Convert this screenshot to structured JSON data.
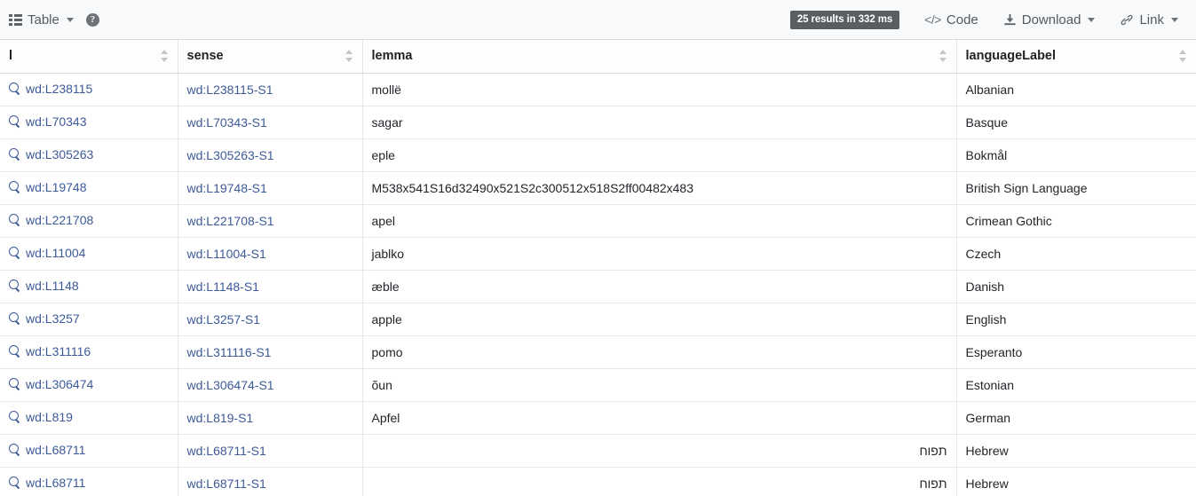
{
  "toolbar": {
    "table_label": "Table",
    "table_icon": "list-icon",
    "help_icon": "help-circle-icon",
    "help_glyph": "?",
    "results_badge": "25 results in 332 ms",
    "code_label": "Code",
    "code_glyph": "</>",
    "download_label": "Download",
    "download_icon": "download-icon",
    "link_label": "Link",
    "link_icon": "link-icon",
    "badge_bg": "#5a5e62",
    "toolbar_bg": "#f8f9fa"
  },
  "table": {
    "columns": [
      {
        "key": "l",
        "label": "l",
        "sortable": true
      },
      {
        "key": "sense",
        "label": "sense",
        "sortable": true
      },
      {
        "key": "lemma",
        "label": "lemma",
        "sortable": true
      },
      {
        "key": "languageLabel",
        "label": "languageLabel",
        "sortable": true
      }
    ],
    "link_color": "#3d5a99",
    "rows": [
      {
        "l": "wd:L238115",
        "sense": "wd:L238115-S1",
        "lemma": "mollë",
        "languageLabel": "Albanian"
      },
      {
        "l": "wd:L70343",
        "sense": "wd:L70343-S1",
        "lemma": "sagar",
        "languageLabel": "Basque"
      },
      {
        "l": "wd:L305263",
        "sense": "wd:L305263-S1",
        "lemma": "eple",
        "languageLabel": "Bokmål"
      },
      {
        "l": "wd:L19748",
        "sense": "wd:L19748-S1",
        "lemma": "M538x541S16d32490x521S2c300512x518S2ff00482x483",
        "languageLabel": "British Sign Language"
      },
      {
        "l": "wd:L221708",
        "sense": "wd:L221708-S1",
        "lemma": "apel",
        "languageLabel": "Crimean Gothic"
      },
      {
        "l": "wd:L11004",
        "sense": "wd:L11004-S1",
        "lemma": "jablko",
        "languageLabel": "Czech"
      },
      {
        "l": "wd:L1148",
        "sense": "wd:L1148-S1",
        "lemma": "æble",
        "languageLabel": "Danish"
      },
      {
        "l": "wd:L3257",
        "sense": "wd:L3257-S1",
        "lemma": "apple",
        "languageLabel": "English"
      },
      {
        "l": "wd:L311116",
        "sense": "wd:L311116-S1",
        "lemma": "pomo",
        "languageLabel": "Esperanto"
      },
      {
        "l": "wd:L306474",
        "sense": "wd:L306474-S1",
        "lemma": "õun",
        "languageLabel": "Estonian"
      },
      {
        "l": "wd:L819",
        "sense": "wd:L819-S1",
        "lemma": "Apfel",
        "languageLabel": "German"
      },
      {
        "l": "wd:L68711",
        "sense": "wd:L68711-S1",
        "lemma": "תפוח",
        "languageLabel": "Hebrew"
      },
      {
        "l": "wd:L68711",
        "sense": "wd:L68711-S1",
        "lemma": "תפוח",
        "languageLabel": "Hebrew"
      }
    ]
  }
}
